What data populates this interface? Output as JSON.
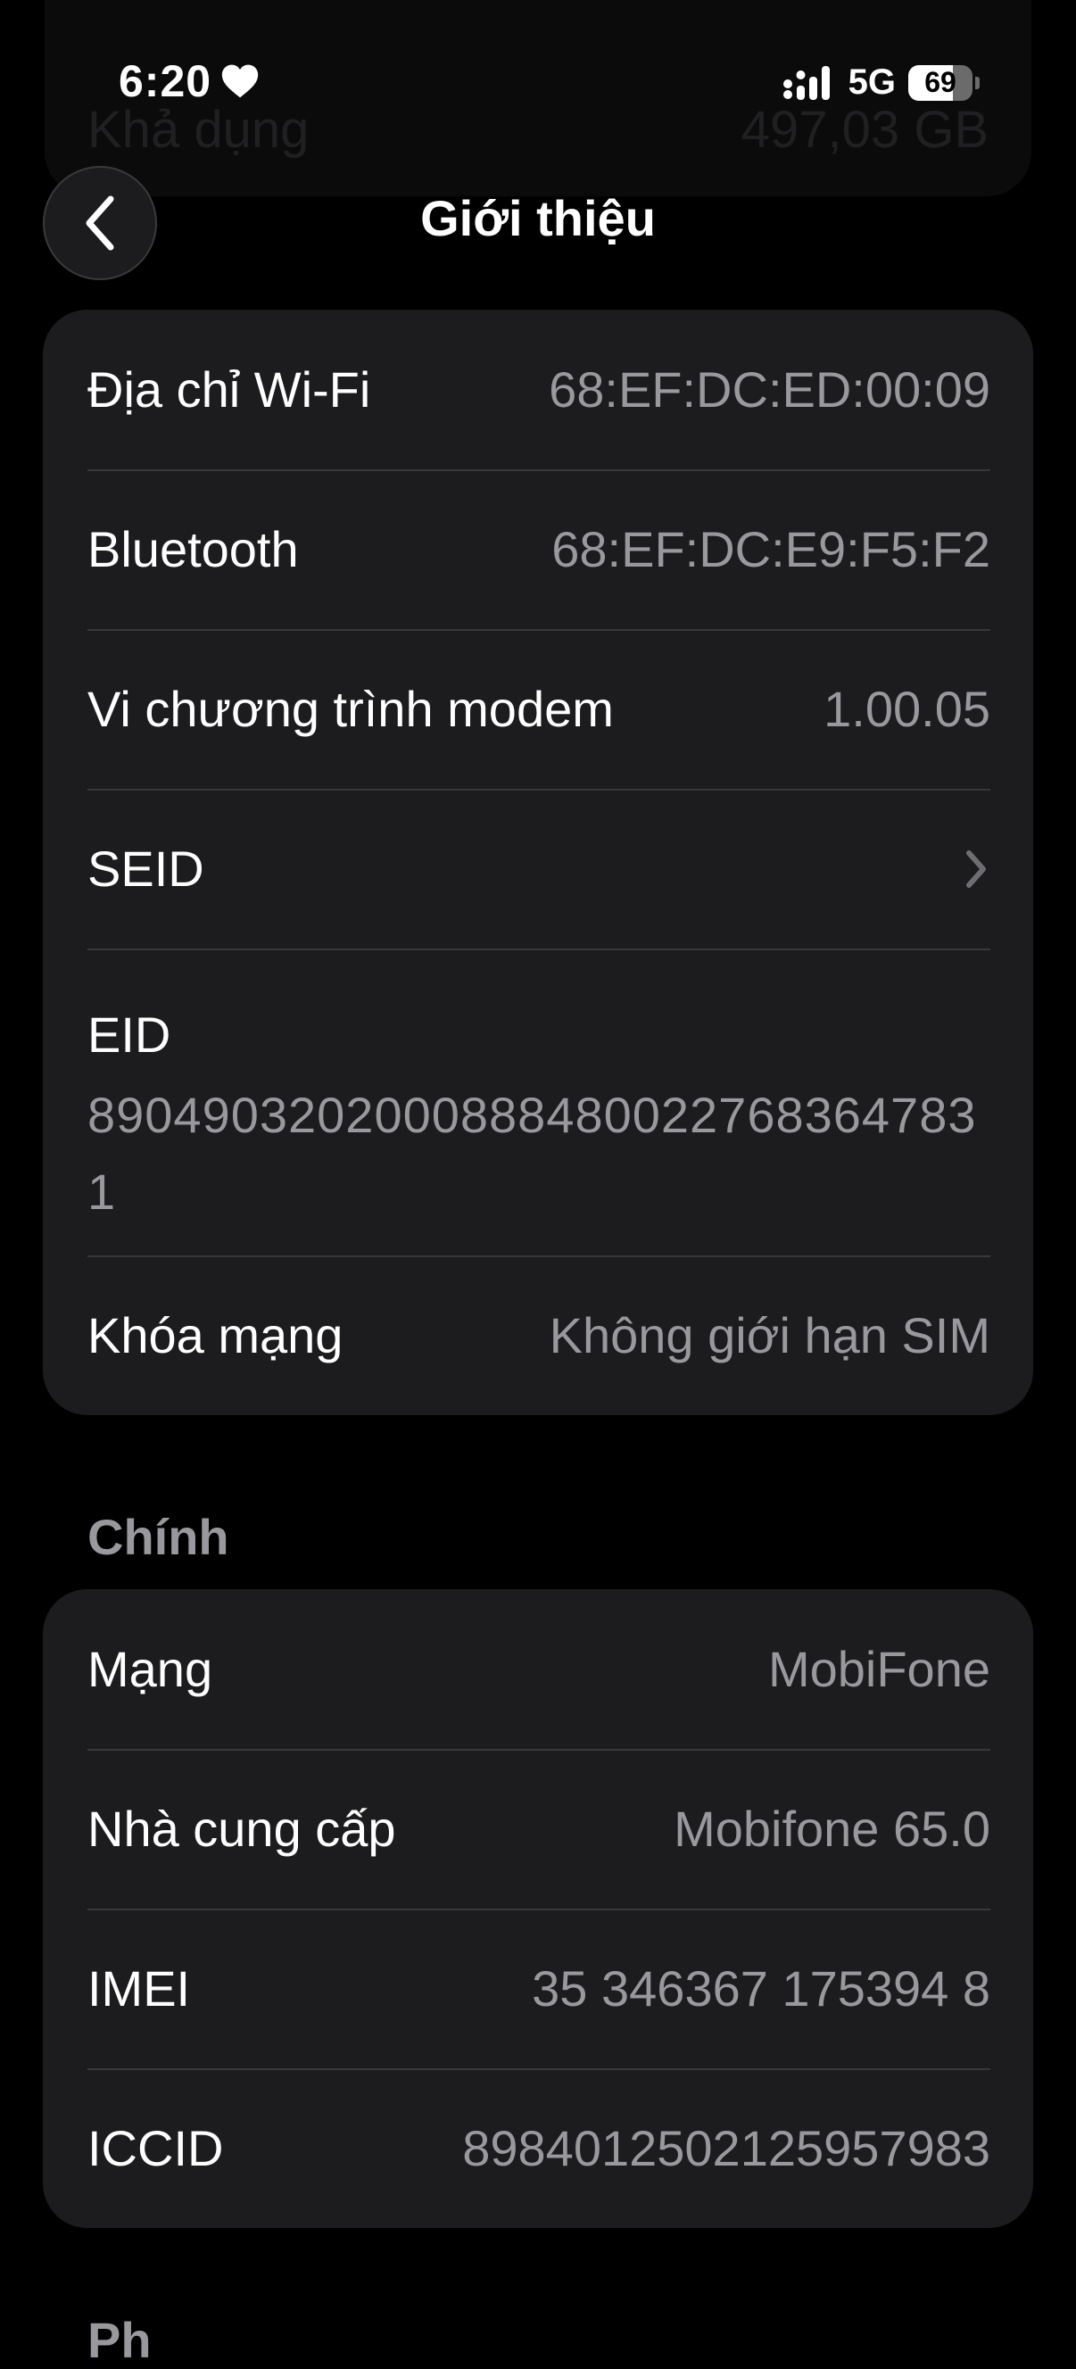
{
  "status_bar": {
    "time": "6:20",
    "network": "5G",
    "battery_level": "69",
    "battery_fraction": 0.69
  },
  "background": {
    "label": "Khả dụng",
    "value": "497,03 GB"
  },
  "nav": {
    "back_icon": "chevron-left-icon",
    "title": "Giới thiệu"
  },
  "card1": {
    "rows": [
      {
        "label": "Địa chỉ Wi-Fi",
        "value": "68:EF:DC:ED:00:09"
      },
      {
        "label": "Bluetooth",
        "value": "68:EF:DC:E9:F5:F2"
      },
      {
        "label": "Vi chương trình modem",
        "value": "1.00.05"
      },
      {
        "label": "SEID",
        "value": ""
      },
      {
        "label": "EID",
        "value": "89049032020008884800227683647831"
      },
      {
        "label": "Khóa mạng",
        "value": "Không giới hạn SIM"
      }
    ]
  },
  "section_primary": "Chính",
  "card2": {
    "rows": [
      {
        "label": "Mạng",
        "value": "MobiFone"
      },
      {
        "label": "Nhà cung cấp",
        "value": "Mobifone 65.0"
      },
      {
        "label": "IMEI",
        "value": "35 346367 175394 8"
      },
      {
        "label": "ICCID",
        "value": "8984012502125957983"
      }
    ]
  },
  "section_next": "Ph"
}
